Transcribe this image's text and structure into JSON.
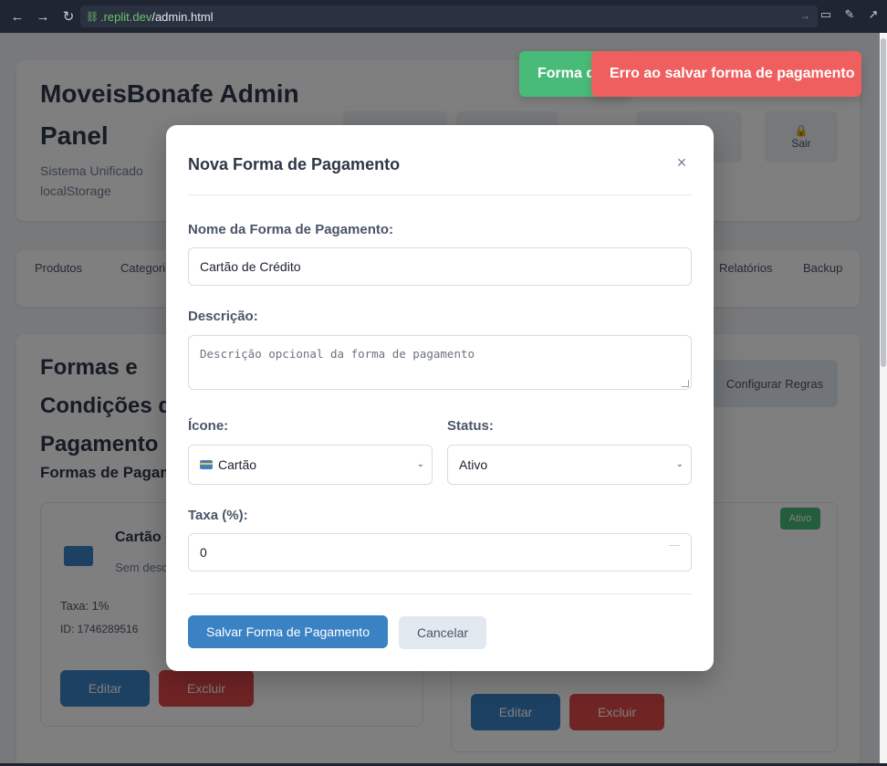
{
  "browser": {
    "url_host": ".replit.dev",
    "url_path": "/admin.html"
  },
  "background": {
    "header_title": "MoveisBonafe Admin Panel",
    "header_subtitle": "Sistema Unificado localStorage",
    "header_buttons": [
      "",
      "",
      "",
      "Sair"
    ],
    "tabs": [
      "Produtos",
      "Categorias",
      "Relatórios",
      "Backup"
    ],
    "section_title": "Formas e Condições de Pagamento",
    "config_button": "Configurar Regras",
    "subsection_title": "Formas de Pagamento",
    "pm_card": {
      "title": "Cartão de Crédito",
      "desc": "Sem descrição",
      "fee": "Taxa: 1%",
      "id": "ID: 1746289516"
    },
    "edit_label": "Editar",
    "delete_label": "Excluir",
    "status_badge": "Ativo"
  },
  "toasts": {
    "success": "Forma de pagamento salva!",
    "error": "Erro ao salvar forma de pagamento"
  },
  "modal": {
    "title": "Nova Forma de Pagamento",
    "close_glyph": "×",
    "name_label": "Nome da Forma de Pagamento:",
    "name_value": "Cartão de Crédito",
    "desc_label": "Descrição:",
    "desc_placeholder": "Descrição opcional da forma de pagamento",
    "icon_label": "Ícone:",
    "icon_value": "Cartão",
    "status_label": "Status:",
    "status_value": "Ativo",
    "fee_label": "Taxa (%):",
    "fee_value": "0",
    "save_button": "Salvar Forma de Pagamento",
    "cancel_button": "Cancelar"
  }
}
